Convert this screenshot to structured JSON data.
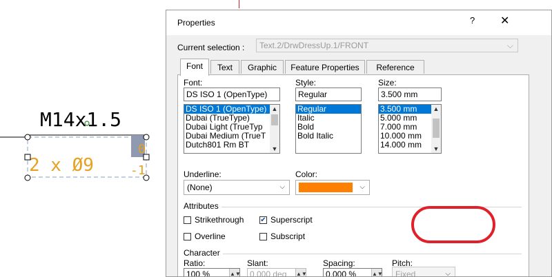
{
  "canvas": {
    "dimension_label": "M14x1.5",
    "annotation_prefix": "2 x Ø9",
    "tolerance_upper": "0",
    "tolerance_lower": "-1",
    "text_color": "#e8a020",
    "line_color": "#000000"
  },
  "dialog": {
    "title": "Properties",
    "help_glyph": "?",
    "close_glyph": "✕",
    "current_selection_label": "Current selection :",
    "current_selection_value": "Text.2/DrwDressUp.1/FRONT",
    "tabs": [
      {
        "label": "Font",
        "active": true
      },
      {
        "label": "Text",
        "active": false
      },
      {
        "label": "Graphic",
        "active": false
      },
      {
        "label": "Feature Properties",
        "active": false
      },
      {
        "label": "Reference",
        "active": false
      }
    ],
    "font": {
      "label": "Font:",
      "value": "DS ISO 1 (OpenType)",
      "options": [
        "DS ISO 1 (OpenType)",
        "Dubai (TrueType)",
        "Dubai Light (TrueTyp",
        "Dubai Medium (TrueT",
        "Dutch801 Rm BT"
      ]
    },
    "style": {
      "label": "Style:",
      "value": "Regular",
      "options": [
        "Regular",
        "Italic",
        "Bold",
        "Bold Italic"
      ]
    },
    "size": {
      "label": "Size:",
      "value": "3.500 mm",
      "options": [
        "3.500 mm",
        "5.000 mm",
        "7.000 mm",
        "10.000 mm",
        "14.000 mm"
      ]
    },
    "underline": {
      "label": "Underline:",
      "value": "(None)"
    },
    "color": {
      "label": "Color:",
      "swatch": "#ff8000"
    },
    "attributes": {
      "title": "Attributes",
      "strikethrough": {
        "label": "Strikethrough",
        "checked": false
      },
      "superscript": {
        "label": "Superscript",
        "checked": true
      },
      "overline": {
        "label": "Overline",
        "checked": false
      },
      "subscript": {
        "label": "Subscript",
        "checked": false
      }
    },
    "character": {
      "title": "Character",
      "ratio": {
        "label": "Ratio:",
        "value": "100 %"
      },
      "slant": {
        "label": "Slant:",
        "value": "0.000 deg"
      },
      "spacing": {
        "label": "Spacing:",
        "value": "0.000 %"
      },
      "pitch": {
        "label": "Pitch:",
        "value": "Fixed"
      }
    }
  },
  "highlight_color": "#e0202a"
}
